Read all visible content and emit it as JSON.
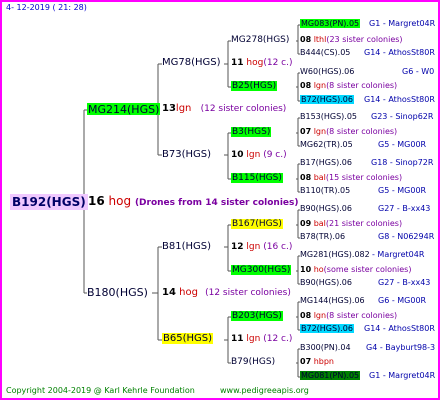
{
  "header": {
    "date": "4- 12-2019 ( 21: 28)"
  },
  "footer": {
    "copyright": "Copyright 2004-2019 @ Karl Kehrle Foundation",
    "site": "www.pedigreeapis.org"
  },
  "root": {
    "id": "B192(HGS)",
    "num": "16",
    "breed": "hog",
    "note": "(Drones from 14 sister colonies)"
  },
  "gen2": {
    "top": {
      "id": "MG214(HGS)",
      "num": "13",
      "breed": "lgn",
      "note": "(12 sister colonies)"
    },
    "bottom": {
      "id": "B180(HGS)",
      "num": "14",
      "breed": "hog",
      "note": "(12 sister colonies)"
    }
  },
  "gen3": {
    "a": {
      "id": "MG78(HGS)",
      "num": "11",
      "breed": "hog",
      "note": "(12 c.)"
    },
    "b": {
      "id": "B73(HGS)",
      "num": "10",
      "breed": "lgn",
      "note": "(9 c.)"
    },
    "c": {
      "id": "B81(HGS)",
      "num": "12",
      "breed": "lgn",
      "note": "(16 c.)"
    },
    "d": {
      "id": "B65(HGS)",
      "num": "11",
      "breed": "lgn",
      "note": "(12 c.)"
    }
  },
  "gen4": {
    "a1": {
      "id": "MG278(HGS)",
      "num": "08",
      "breed": "lthl",
      "note": "(23 sister colonies)"
    },
    "a2": {
      "id": "B25(HGS)",
      "num": "08",
      "breed": "lgn",
      "note": "(8 sister colonies)"
    },
    "b1": {
      "id": "B3(HGS)",
      "num": "07",
      "breed": "lgn",
      "note": "(8 sister colonies)"
    },
    "b2": {
      "id": "B115(HGS)",
      "num": "08",
      "breed": "bal",
      "note": "(15 sister colonies)"
    },
    "c1": {
      "id": "B167(HGS)",
      "num": "09",
      "breed": "bal",
      "note": "(21 sister colonies)"
    },
    "c2": {
      "id": "MG300(HGS)",
      "num": "10",
      "breed": "ho",
      "note": "(some sister colonies)"
    },
    "d1": {
      "id": "B203(HGS)",
      "num": "08",
      "breed": "lgn",
      "note": "(8 sister colonies)"
    },
    "d2": {
      "id": "B79(HGS)",
      "num": "07",
      "breed": "hbpn",
      "note": ""
    }
  },
  "gen5": [
    {
      "id": "MG083(PN).05",
      "code": "G1 - Margret04R"
    },
    {
      "id": "B444(CS).05",
      "code": "G14 - AthosSt80R"
    },
    {
      "id": "W60(HGS).06",
      "code": "G6 - W0"
    },
    {
      "id": "B72(HGS).06",
      "code": "G14 - AthosSt80R"
    },
    {
      "id": "B153(HGS).05",
      "code": "G23 - Sinop62R"
    },
    {
      "id": "MG62(TR).05",
      "code": "G5 - MG00R"
    },
    {
      "id": "B17(HGS).06",
      "code": "G18 - Sinop72R"
    },
    {
      "id": "B110(TR).05",
      "code": "G5 - MG00R"
    },
    {
      "id": "B90(HGS).06",
      "code": "G27 - B-xx43"
    },
    {
      "id": "B78(TR).06",
      "code": "G8 - N06294R"
    },
    {
      "id": "MG281(HGS).082",
      "code": "- Margret04R"
    },
    {
      "id": "B90(HGS).06",
      "code": "G27 - B-xx43"
    },
    {
      "id": "MG144(HGS).06",
      "code": "G6 - MG00R"
    },
    {
      "id": "B72(HGS).06",
      "code": "G14 - AthosSt80R"
    },
    {
      "id": "B300(PN).04",
      "code": "G4 - Bayburt98-3"
    },
    {
      "id": "MG081(PN).05",
      "code": "G1 - Margret04R"
    }
  ]
}
